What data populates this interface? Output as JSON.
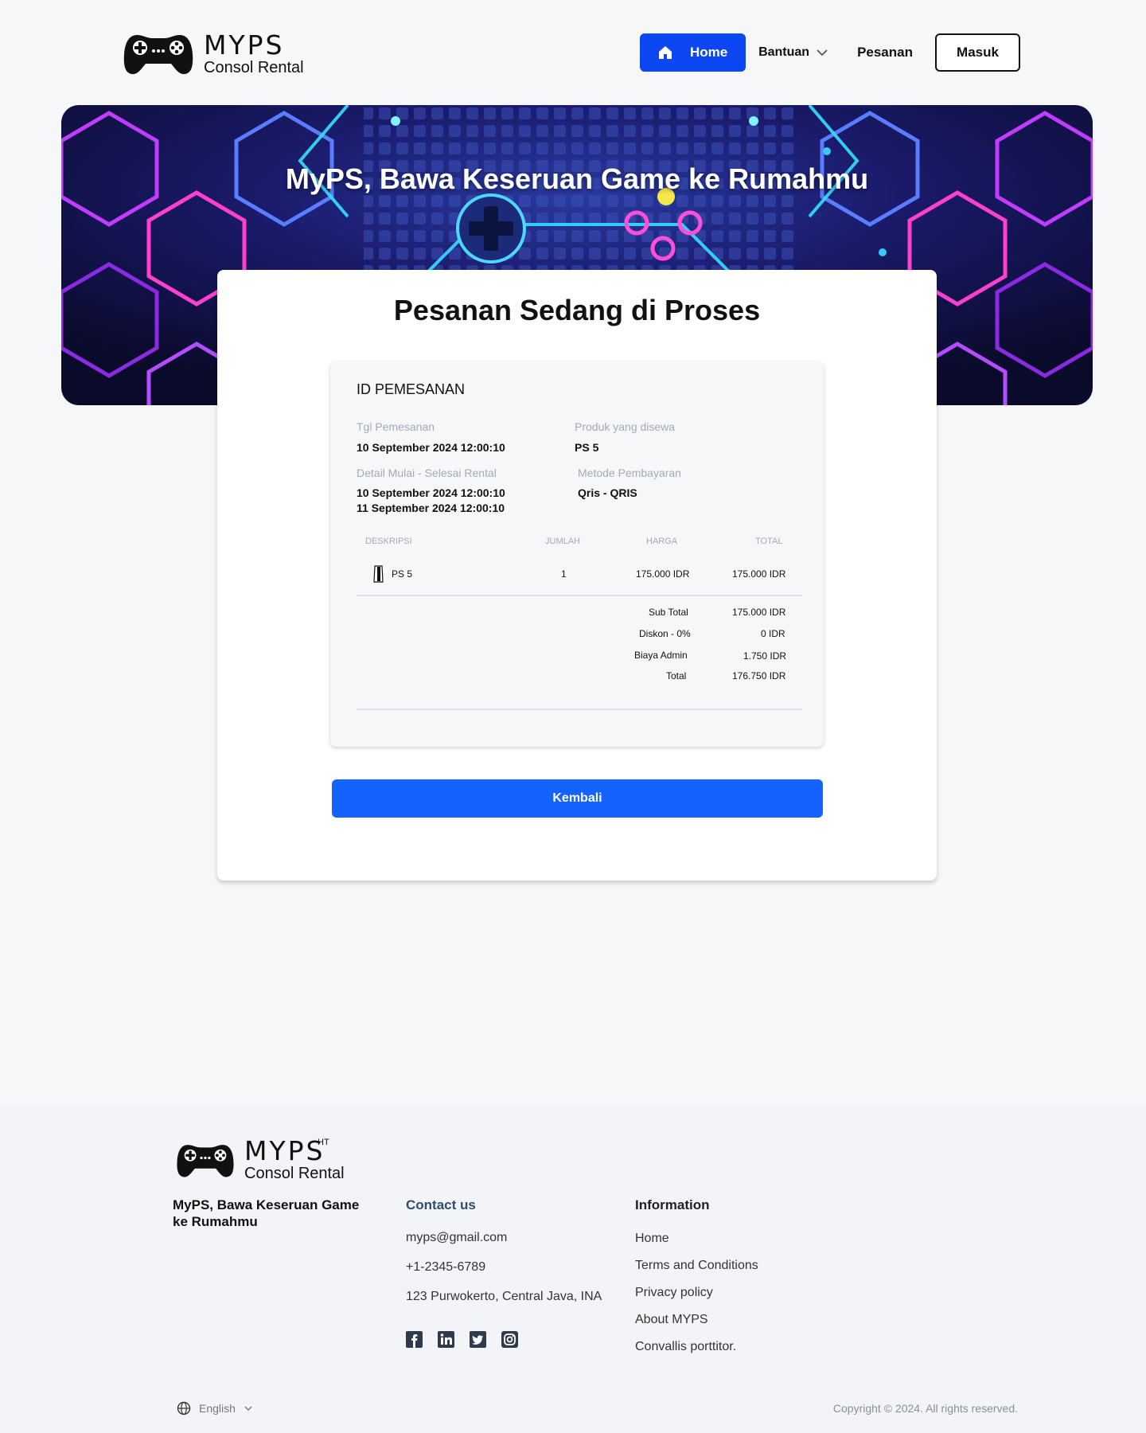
{
  "brand": {
    "name": "MYPS",
    "subtitle": "Consol Rental",
    "footer_mark": "HT"
  },
  "nav": {
    "home": "Home",
    "bantuan": "Bantuan",
    "pesanan": "Pesanan",
    "masuk": "Masuk"
  },
  "hero": {
    "title": "MyPS, Bawa Keseruan Game ke Rumahmu"
  },
  "card": {
    "title": "Pesanan Sedang di Proses",
    "order": {
      "id_label": "ID PEMESANAN",
      "tgl_label": "Tgl Pemesanan",
      "tgl_value": "10 September 2024  12:00:10",
      "produk_label": "Produk yang disewa",
      "produk_value": "PS 5",
      "detail_label": "Detail Mulai - Selesai Rental",
      "detail_start": "10 September 2024  12:00:10",
      "detail_end": "11 September 2024  12:00:10",
      "metode_label": "Metode Pembayaran",
      "metode_value": "Qris - QRIS",
      "columns": {
        "desc": "DESKRIPSI",
        "qty": "JUMLAH",
        "price": "HARGA",
        "total": "TOTAL"
      },
      "item": {
        "name": "PS 5",
        "qty": "1",
        "price": "175.000 IDR",
        "total": "175.000 IDR"
      },
      "summary": {
        "subtotal_label": "Sub Total",
        "subtotal_value": "175.000 IDR",
        "diskon_label": "Diskon - 0%",
        "diskon_value": "0 IDR",
        "admin_label": "Biaya Admin",
        "admin_value": "1.750 IDR",
        "total_label": "Total",
        "total_value": "176.750 IDR"
      }
    },
    "back_button": "Kembali"
  },
  "footer": {
    "tagline": "MyPS, Bawa Keseruan Game ke Rumahmu",
    "contact": {
      "title": "Contact us",
      "email": "myps@gmail.com",
      "phone": "+1-2345-6789",
      "address": "123 Purwokerto, Central Java, INA"
    },
    "information": {
      "title": "Information",
      "links": [
        "Home",
        "Terms and Conditions",
        "Privacy policy",
        "About MYPS",
        "Convallis porttitor."
      ]
    },
    "social_icons": [
      "facebook-icon",
      "linkedin-icon",
      "twitter-icon",
      "instagram-icon"
    ],
    "language": "English",
    "copyright": "Copyright © 2024. All rights reserved."
  },
  "colors": {
    "primary": "#0d47f2",
    "button": "#1463ff",
    "background": "#f6f7f9",
    "footer": "#f2f4f7"
  }
}
